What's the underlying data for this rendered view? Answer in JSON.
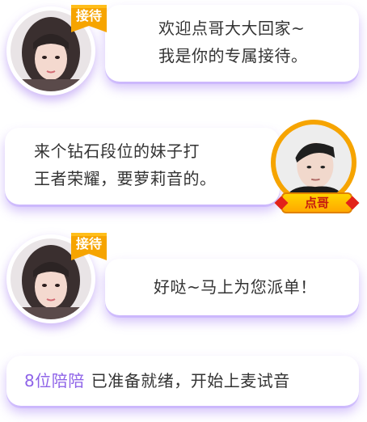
{
  "messages": [
    {
      "role": "host",
      "text": "欢迎点哥大大回家~\n我是你的专属接待。"
    },
    {
      "role": "user",
      "text": "来个钻石段位的妹子打\n王者荣耀，要萝莉音的。"
    },
    {
      "role": "host",
      "text": "好哒~马上为您派单！"
    }
  ],
  "status": {
    "count_text": "8位陪陪",
    "message": "已准备就绪，开始上麦试音"
  },
  "badges": {
    "host_badge": "接待",
    "user_name": "点哥"
  },
  "colors": {
    "accent_purple": "#8E63E8",
    "ribbon_orange": "#F6A400",
    "name_badge_yellow": "#FFD400",
    "name_badge_red": "#E2231A"
  }
}
